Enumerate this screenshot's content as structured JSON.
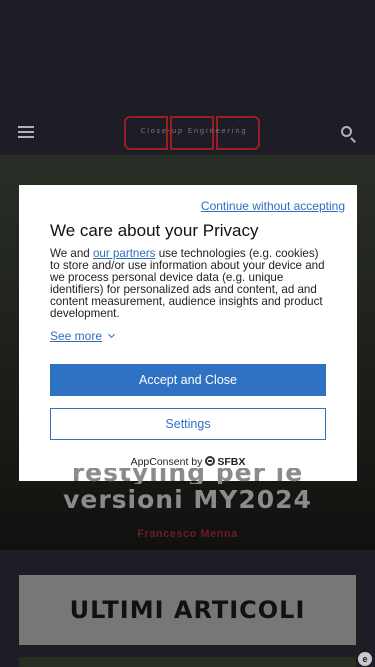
{
  "header": {
    "logo_text": "Close-up Engineering",
    "menu_icon": "hamburger-menu-icon",
    "search_icon": "search-icon"
  },
  "hero": {
    "title_line1": "restyling per le",
    "title_line2": "versioni MY2024",
    "author": "Francesco Menna"
  },
  "section": {
    "title": "ULTIMI ARTICOLI"
  },
  "consent": {
    "continue_label": "Continue without accepting",
    "title": "We care about your Privacy",
    "body_prefix": "We and ",
    "partners_link": "our partners",
    "body_suffix": " use technologies (e.g. cookies) to store and/or use information about your device and we process personal device data (e.g. unique identifiers) for personalized ads and content, ad and content measurement, audience insights and product development.",
    "see_more": "See more",
    "accept_label": "Accept and Close",
    "settings_label": "Settings",
    "footer_prefix": "AppConsent by",
    "footer_brand": "SFBX"
  },
  "colors": {
    "accent_blue": "#2f72c4",
    "link_blue": "#2f6fbf",
    "brand_red": "#b3262c",
    "page_bg": "#24232c"
  }
}
